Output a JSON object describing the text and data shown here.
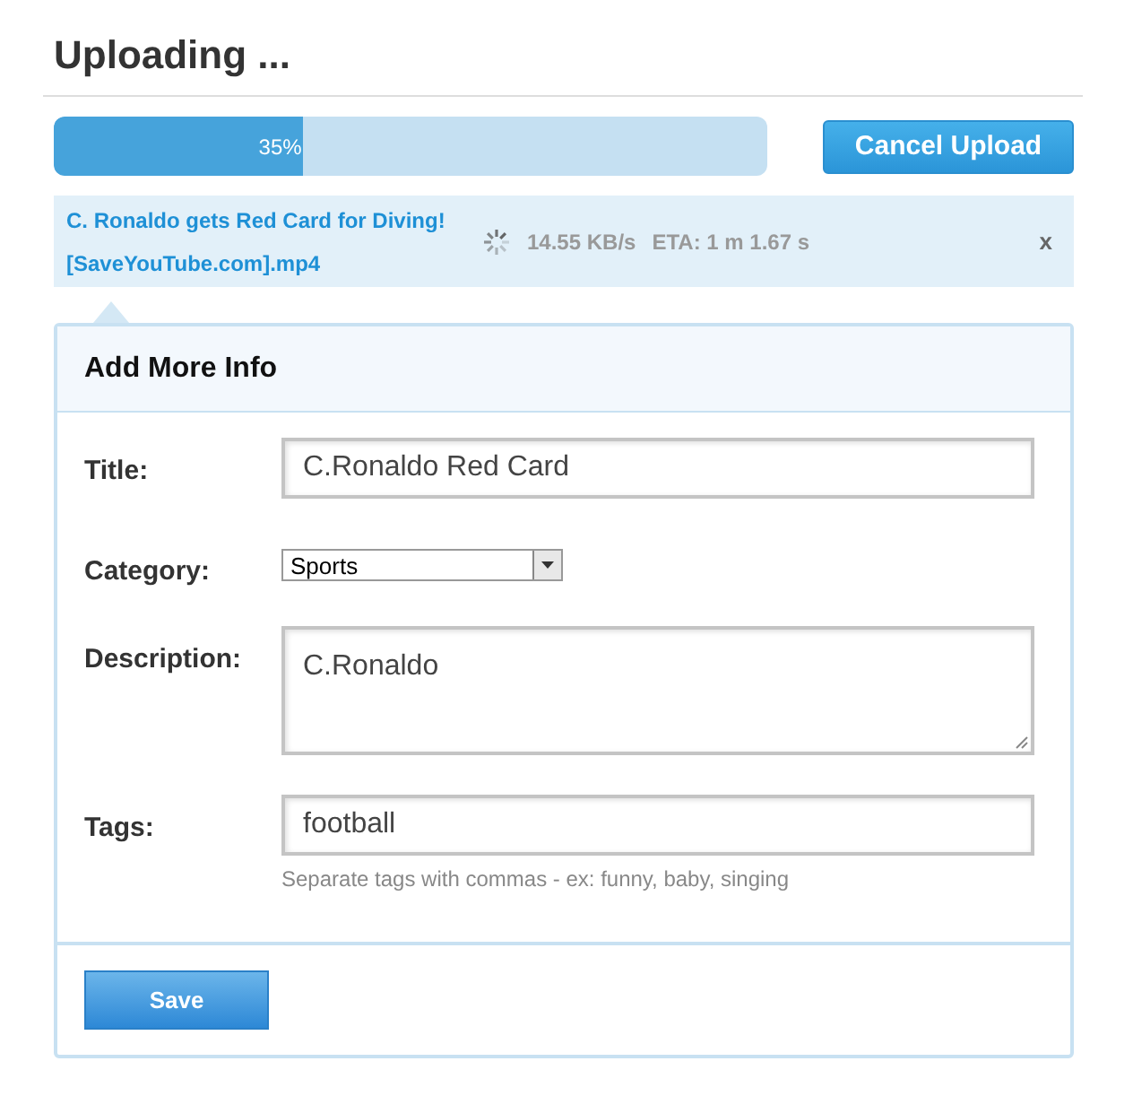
{
  "heading": "Uploading ...",
  "progress": {
    "level": 0.35,
    "label": "35%"
  },
  "cancel_button": "Cancel Upload",
  "upload": {
    "name_line_1": "C. Ronaldo gets Red Card for Diving!",
    "name_line_2": "[SaveYouTube.com].mp4",
    "speed": "14.55 KB/s",
    "eta": "ETA: 1 m 1.67 s",
    "close": "x"
  },
  "panel": {
    "title": "Add More Info",
    "fields": [
      {
        "kind": "text",
        "label": "Title:",
        "value": "C.Ronaldo Red Card"
      },
      {
        "kind": "select",
        "label": "Category:",
        "value": "Sports"
      },
      {
        "kind": "textarea",
        "label": "Description:",
        "value": "C.Ronaldo"
      },
      {
        "kind": "text",
        "label": "Tags:",
        "value": "football",
        "hint": "Separate tags with commas - ex: funny, baby, singing"
      }
    ],
    "save_button": "Save"
  }
}
